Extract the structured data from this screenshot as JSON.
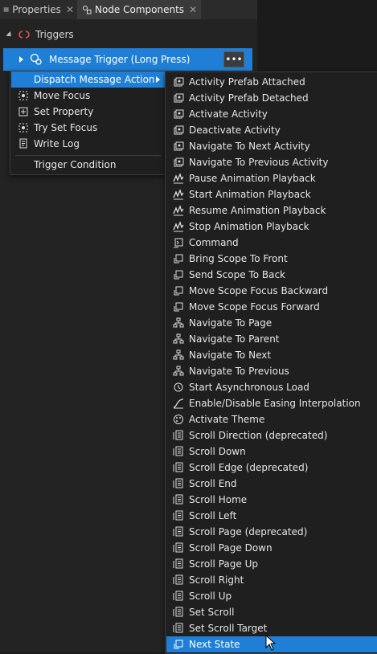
{
  "tabs": [
    {
      "label": "Properties",
      "close": "✕"
    },
    {
      "label": "Node Components",
      "close": "✕"
    }
  ],
  "section": {
    "label": "Triggers"
  },
  "trigger": {
    "label": "Message Trigger (Long Press)",
    "more": "•••"
  },
  "menu": {
    "items": [
      {
        "label": "Dispatch Message Action",
        "icon": "none",
        "selected": true,
        "submenu": true
      },
      {
        "label": "Move Focus",
        "icon": "focus-icon"
      },
      {
        "label": "Set Property",
        "icon": "property-icon"
      },
      {
        "label": "Try Set Focus",
        "icon": "focus-icon"
      },
      {
        "label": "Write Log",
        "icon": "log-icon"
      }
    ],
    "footer": {
      "label": "Trigger Condition"
    }
  },
  "submenu": {
    "items": [
      {
        "label": "Activity Prefab Attached",
        "icon": "activity-icon"
      },
      {
        "label": "Activity Prefab Detached",
        "icon": "activity-icon"
      },
      {
        "label": "Activate Activity",
        "icon": "activity-icon"
      },
      {
        "label": "Deactivate Activity",
        "icon": "activity-icon"
      },
      {
        "label": "Navigate To Next Activity",
        "icon": "activity-icon"
      },
      {
        "label": "Navigate To Previous Activity",
        "icon": "activity-icon"
      },
      {
        "label": "Pause Animation Playback",
        "icon": "animation-icon"
      },
      {
        "label": "Start Animation Playback",
        "icon": "animation-icon"
      },
      {
        "label": "Resume Animation Playback",
        "icon": "animation-icon"
      },
      {
        "label": "Stop Animation Playback",
        "icon": "animation-icon"
      },
      {
        "label": "Command",
        "icon": "command-icon"
      },
      {
        "label": "Bring Scope To Front",
        "icon": "scope-icon"
      },
      {
        "label": "Send Scope To Back",
        "icon": "scope-icon"
      },
      {
        "label": "Move Scope Focus Backward",
        "icon": "scope-icon"
      },
      {
        "label": "Move Scope Focus Forward",
        "icon": "scope-icon"
      },
      {
        "label": "Navigate To Page",
        "icon": "page-icon"
      },
      {
        "label": "Navigate To Parent",
        "icon": "page-icon"
      },
      {
        "label": "Navigate To Next",
        "icon": "page-icon"
      },
      {
        "label": "Navigate To Previous",
        "icon": "page-icon"
      },
      {
        "label": "Start Asynchronous Load",
        "icon": "load-icon"
      },
      {
        "label": "Enable/Disable Easing Interpolation",
        "icon": "easing-icon"
      },
      {
        "label": "Activate Theme",
        "icon": "theme-icon"
      },
      {
        "label": "Scroll Direction (deprecated)",
        "icon": "scroll-icon"
      },
      {
        "label": "Scroll Down",
        "icon": "scroll-icon"
      },
      {
        "label": "Scroll Edge (deprecated)",
        "icon": "scroll-icon"
      },
      {
        "label": "Scroll End",
        "icon": "scroll-icon"
      },
      {
        "label": "Scroll Home",
        "icon": "scroll-icon"
      },
      {
        "label": "Scroll Left",
        "icon": "scroll-icon"
      },
      {
        "label": "Scroll Page (deprecated)",
        "icon": "scroll-icon"
      },
      {
        "label": "Scroll Page Down",
        "icon": "scroll-icon"
      },
      {
        "label": "Scroll Page Up",
        "icon": "scroll-icon"
      },
      {
        "label": "Scroll Right",
        "icon": "scroll-icon"
      },
      {
        "label": "Scroll Up",
        "icon": "scroll-icon"
      },
      {
        "label": "Set Scroll",
        "icon": "scroll-icon"
      },
      {
        "label": "Set Scroll Target",
        "icon": "scroll-icon"
      },
      {
        "label": "Next State",
        "icon": "state-icon",
        "selected": true
      }
    ]
  },
  "colors": {
    "accent": "#1f7fd6",
    "menu_bg": "#1f1f1f",
    "panel_bg": "#232323"
  }
}
